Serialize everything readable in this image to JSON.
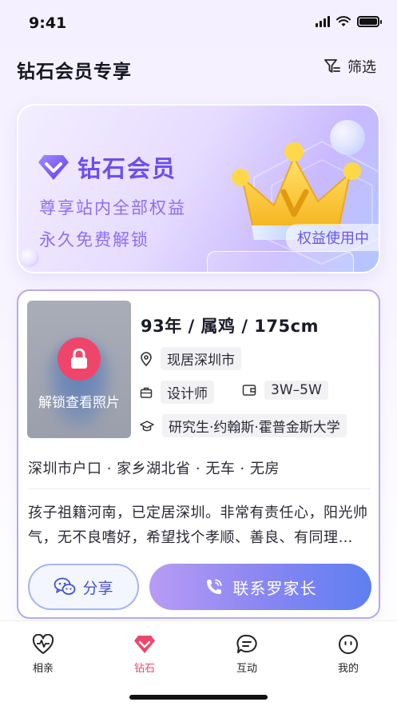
{
  "status_bar": {
    "time": "9:41"
  },
  "header": {
    "title": "钻石会员专享",
    "filter_label": "筛选"
  },
  "banner": {
    "title": "钻石会员",
    "line1": "尊享站内全部权益",
    "line2": "永久免费解锁",
    "badge": "权益使用中"
  },
  "profile": {
    "photo_label": "解锁查看照片",
    "basic": "93年 / 属鸡 / 175cm",
    "location": "现居深圳市",
    "job": "设计师",
    "income": "3W–5W",
    "education": "研究生·约翰斯·霍普金斯大学",
    "meta": "深圳市户口 · 家乡湖北省 · 无车 · 无房",
    "description": "孩子祖籍河南，已定居深圳。非常有责任心，阳光帅气，无不良嗜好，希望找个孝顺、善良、有同理…",
    "share_label": "分享",
    "contact_label": "联系罗家长"
  },
  "nav": {
    "items": [
      {
        "label": "相亲",
        "icon": "heartbeat-icon"
      },
      {
        "label": "钻石",
        "icon": "diamond-icon",
        "active": true
      },
      {
        "label": "互动",
        "icon": "chat-icon"
      },
      {
        "label": "我的",
        "icon": "profile-icon"
      }
    ]
  },
  "colors": {
    "accent": "#6a4ff0",
    "active_nav": "#f0456a",
    "lock": "#f0456a"
  }
}
